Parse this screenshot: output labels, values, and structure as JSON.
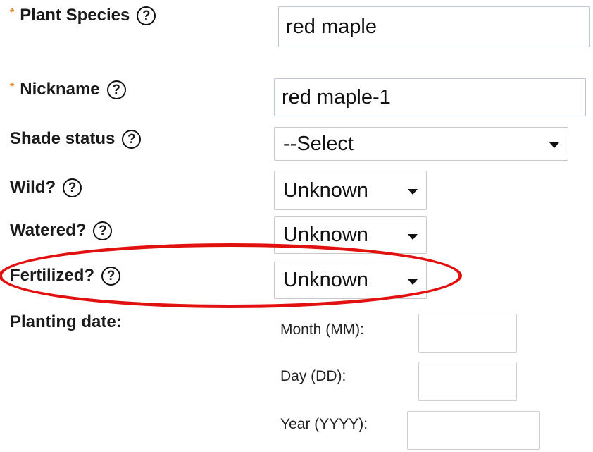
{
  "fields": {
    "plant_species": {
      "label": "Plant Species",
      "value": "red maple",
      "required": "*"
    },
    "nickname": {
      "label": "Nickname",
      "value": "red maple-1",
      "required": "*"
    },
    "shade_status": {
      "label": "Shade status",
      "value": "--Select"
    },
    "wild": {
      "label": "Wild?",
      "value": "Unknown"
    },
    "watered": {
      "label": "Watered?",
      "value": "Unknown"
    },
    "fertilized": {
      "label": "Fertilized?",
      "value": "Unknown"
    },
    "planting_date": {
      "label": "Planting date:",
      "month_label": "Month (MM):",
      "day_label": "Day (DD):",
      "year_label": "Year (YYYY):"
    }
  },
  "help_glyph": "?",
  "icons": {
    "help": "help-circle-icon",
    "dropdown": "chevron-down-icon"
  },
  "colors": {
    "required_asterisk": "#e08a2a",
    "highlight_ring": "#e31010"
  }
}
